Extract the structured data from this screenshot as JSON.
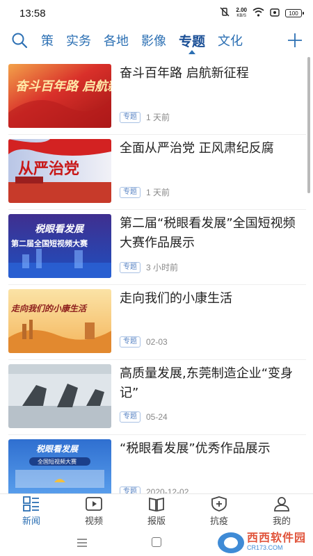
{
  "status": {
    "time": "13:58",
    "net_speed": "2.00",
    "net_unit": "KB/S",
    "battery": "100"
  },
  "tabs": [
    "策",
    "实务",
    "各地",
    "影像",
    "专题",
    "文化"
  ],
  "active_tab": "专题",
  "articles": [
    {
      "title": "奋斗百年路 启航新征程",
      "tag": "专题",
      "time": "1 天前",
      "thumb_text": "奋斗百年路 启航新征程"
    },
    {
      "title": "全面从严治党 正风肃纪反腐",
      "tag": "专题",
      "time": "1 天前",
      "thumb_text": "从严治党"
    },
    {
      "title": "第二届“税眼看发展”全国短视频大赛作品展示",
      "tag": "专题",
      "time": "3 小时前",
      "thumb_text": "税眼看发展",
      "thumb_sub": "第二届全国短视频大赛"
    },
    {
      "title": "走向我们的小康生活",
      "tag": "专题",
      "time": "02-03",
      "thumb_text": "走向我们的小康生活"
    },
    {
      "title": "高质量发展,东莞制造企业“变身记”",
      "tag": "专题",
      "time": "05-24",
      "thumb_text": ""
    },
    {
      "title": "“税眼看发展”优秀作品展示",
      "tag": "专题",
      "time": "2020-12-02",
      "thumb_text": "税眼看发展",
      "thumb_sub": "全国短视频大赛"
    }
  ],
  "bottom_nav": [
    {
      "label": "新闻",
      "icon": "news-icon",
      "active": true
    },
    {
      "label": "视频",
      "icon": "video-icon",
      "active": false
    },
    {
      "label": "报版",
      "icon": "newspaper-icon",
      "active": false
    },
    {
      "label": "抗疫",
      "icon": "shield-plus-icon",
      "active": false
    },
    {
      "label": "我的",
      "icon": "user-icon",
      "active": false
    }
  ],
  "watermark": {
    "name": "西西软件园",
    "url": "CR173.COM"
  },
  "colors": {
    "accent": "#2b6fb3",
    "active_tab": "#1a4f96",
    "tag_border": "#a8c1e4"
  }
}
